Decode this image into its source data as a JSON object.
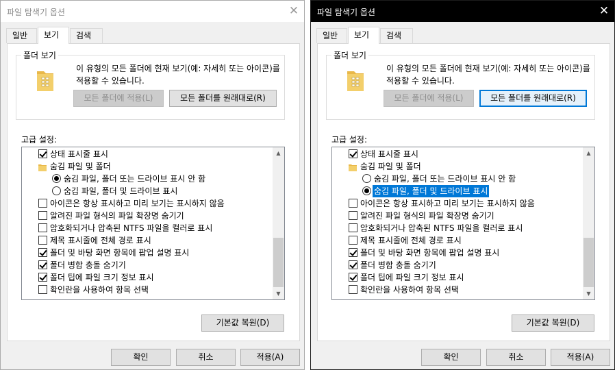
{
  "dialogs": [
    {
      "title": "파일 탐색기 옵션",
      "tabs": [
        "일반",
        "보기",
        "검색"
      ],
      "active_tab": "보기",
      "folder_views": {
        "legend": "폴더 보기",
        "description": "이 유형의 모든 폴더에 현재 보기(예: 자세히 또는 아이콘)를 적용할 수 있습니다.",
        "apply_button": "모든 폴더에 적용(L)",
        "reset_button": "모든 폴더를 원래대로(R)",
        "reset_button_focused": false
      },
      "advanced_label": "고급 설정:",
      "settings": [
        {
          "type": "checkbox",
          "checked": true,
          "indent": 1,
          "label": "상태 표시줄 표시"
        },
        {
          "type": "folder",
          "indent": 1,
          "label": "숨김 파일 및 폴더"
        },
        {
          "type": "radio",
          "checked": true,
          "indent": 2,
          "label": "숨김 파일, 폴더 또는 드라이브 표시 안 함"
        },
        {
          "type": "radio",
          "checked": false,
          "indent": 2,
          "label": "숨김 파일, 폴더 및 드라이브 표시"
        },
        {
          "type": "checkbox",
          "checked": false,
          "indent": 1,
          "label": "아이콘은 항상 표시하고 미리 보기는 표시하지 않음"
        },
        {
          "type": "checkbox",
          "checked": false,
          "indent": 1,
          "label": "알려진 파일 형식의 파일 확장명 숨기기"
        },
        {
          "type": "checkbox",
          "checked": false,
          "indent": 1,
          "label": "암호화되거나 압축된 NTFS 파일을 컬러로 표시"
        },
        {
          "type": "checkbox",
          "checked": false,
          "indent": 1,
          "label": "제목 표시줄에 전체 경로 표시"
        },
        {
          "type": "checkbox",
          "checked": true,
          "indent": 1,
          "label": "폴더 및 바탕 화면 항목에 팝업 설명 표시"
        },
        {
          "type": "checkbox",
          "checked": true,
          "indent": 1,
          "label": "폴더 병합 충돌 숨기기"
        },
        {
          "type": "checkbox",
          "checked": true,
          "indent": 1,
          "label": "폴더 팁에 파일 크기 정보 표시"
        },
        {
          "type": "checkbox",
          "checked": false,
          "indent": 1,
          "label": "확인란을 사용하여 항목 선택"
        }
      ],
      "selected_row": -1,
      "restore_defaults": "기본값 복원(D)",
      "ok": "확인",
      "cancel": "취소",
      "apply": "적용(A)"
    },
    {
      "title": "파일 탐색기 옵션",
      "tabs": [
        "일반",
        "보기",
        "검색"
      ],
      "active_tab": "보기",
      "folder_views": {
        "legend": "폴더 보기",
        "description": "이 유형의 모든 폴더에 현재 보기(예: 자세히 또는 아이콘)를 적용할 수 있습니다.",
        "apply_button": "모든 폴더에 적용(L)",
        "reset_button": "모든 폴더를 원래대로(R)",
        "reset_button_focused": true
      },
      "advanced_label": "고급 설정:",
      "settings": [
        {
          "type": "checkbox",
          "checked": true,
          "indent": 1,
          "label": "상태 표시줄 표시"
        },
        {
          "type": "folder",
          "indent": 1,
          "label": "숨김 파일 및 폴더"
        },
        {
          "type": "radio",
          "checked": false,
          "indent": 2,
          "label": "숨김 파일, 폴더 또는 드라이브 표시 안 함"
        },
        {
          "type": "radio",
          "checked": true,
          "indent": 2,
          "label": "숨김 파일, 폴더 및 드라이브 표시"
        },
        {
          "type": "checkbox",
          "checked": false,
          "indent": 1,
          "label": "아이콘은 항상 표시하고 미리 보기는 표시하지 않음"
        },
        {
          "type": "checkbox",
          "checked": false,
          "indent": 1,
          "label": "알려진 파일 형식의 파일 확장명 숨기기"
        },
        {
          "type": "checkbox",
          "checked": false,
          "indent": 1,
          "label": "암호화되거나 압축된 NTFS 파일을 컬러로 표시"
        },
        {
          "type": "checkbox",
          "checked": false,
          "indent": 1,
          "label": "제목 표시줄에 전체 경로 표시"
        },
        {
          "type": "checkbox",
          "checked": true,
          "indent": 1,
          "label": "폴더 및 바탕 화면 항목에 팝업 설명 표시"
        },
        {
          "type": "checkbox",
          "checked": true,
          "indent": 1,
          "label": "폴더 병합 충돌 숨기기"
        },
        {
          "type": "checkbox",
          "checked": true,
          "indent": 1,
          "label": "폴더 팁에 파일 크기 정보 표시"
        },
        {
          "type": "checkbox",
          "checked": false,
          "indent": 1,
          "label": "확인란을 사용하여 항목 선택"
        }
      ],
      "selected_row": 3,
      "restore_defaults": "기본값 복원(D)",
      "ok": "확인",
      "cancel": "취소",
      "apply": "적용(A)"
    }
  ],
  "icons": {
    "folder": "folder-icon",
    "close": "close-icon",
    "scroll_up": "chevron-up-icon",
    "scroll_down": "chevron-down-icon"
  },
  "colors": {
    "selection": "#0078d7",
    "folder_yellow": "#f3cf6b"
  }
}
